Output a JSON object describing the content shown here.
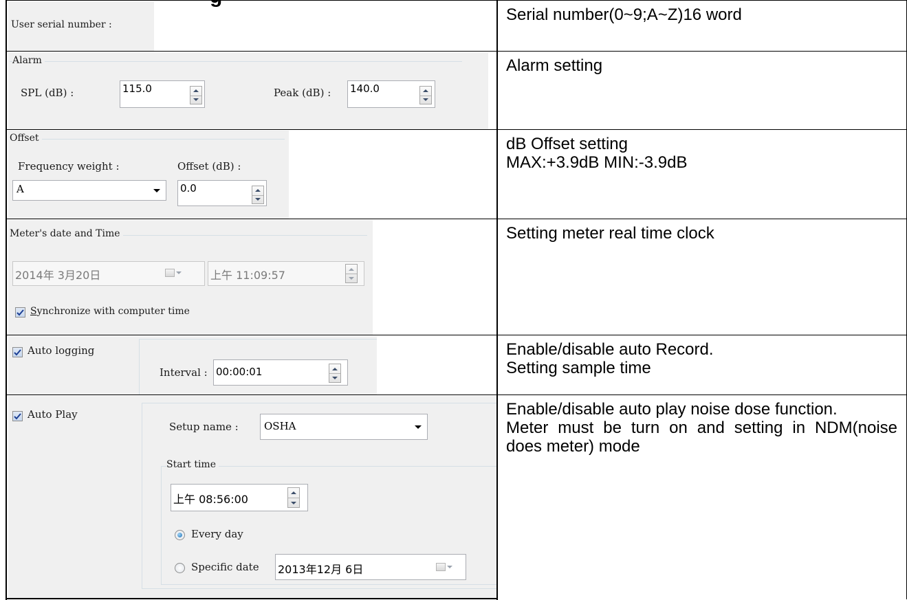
{
  "page": {
    "heading": "g"
  },
  "rows": {
    "serial": {
      "label": "User serial number :",
      "desc": "Serial number(0~9;A~Z)16 word"
    },
    "alarm": {
      "group_title": "Alarm",
      "spl_label": "SPL (dB) :",
      "spl_value": "115.0",
      "peak_label": "Peak (dB) :",
      "peak_value": "140.0",
      "desc": "Alarm setting"
    },
    "offset": {
      "group_title": "Offset",
      "freq_label": "Frequency weight :",
      "freq_value": "A",
      "offset_label": "Offset (dB) :",
      "offset_value": "0.0",
      "desc_line1": "dB Offset setting",
      "desc_line2": "MAX:+3.9dB MIN:-3.9dB"
    },
    "datetime": {
      "group_title": "Meter's date and Time",
      "date_value": "2014年 3月20日",
      "time_value": "上午 11:09:57",
      "sync_label_first": "S",
      "sync_label_rest": "ynchronize with computer time",
      "sync_checked": true,
      "desc": "Setting meter real time clock"
    },
    "autolog": {
      "checkbox_label": "Auto logging",
      "checked": true,
      "interval_label": "Interval :",
      "interval_value": "00:00:01",
      "desc_line1": "Enable/disable auto Record.",
      "desc_line2": "Setting sample time"
    },
    "autoplay": {
      "checkbox_label": "Auto Play",
      "checked": true,
      "setup_label": "Setup name :",
      "setup_value": "OSHA",
      "start_group_title": "Start time",
      "start_time_value": "上午 08:56:00",
      "every_day_label": "Every day",
      "every_day_selected": true,
      "specific_date_label": "Specific date",
      "specific_date_value": "2013年12月 6日",
      "desc_line1": "Enable/disable auto play noise dose function.",
      "desc_line2": "Meter must be turn on and setting in NDM(noise does meter) mode"
    }
  },
  "colors": {
    "panel_bg": "#f0f0f0",
    "check_color": "#1c3f94",
    "radio_fill": "#1f6fb2"
  }
}
